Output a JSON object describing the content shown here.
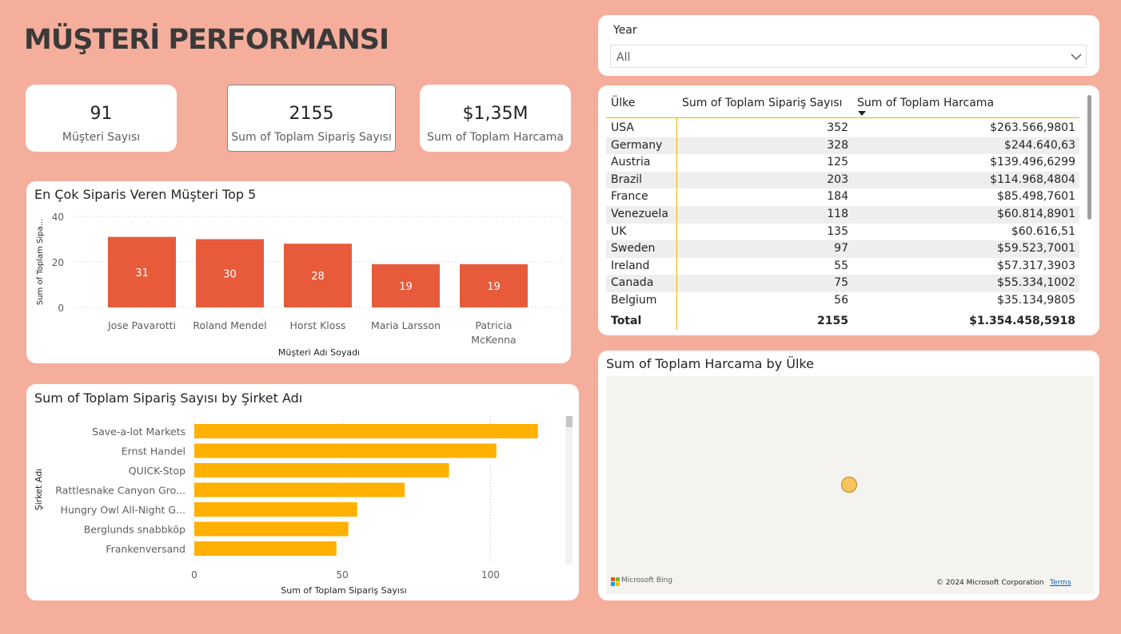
{
  "page": {
    "title": "MÜŞTERİ PERFORMANSI"
  },
  "kpis": [
    {
      "value": "91",
      "label": "Müşteri Sayısı"
    },
    {
      "value": "2155",
      "label": "Sum of Toplam Sipariş Sayısı"
    },
    {
      "value": "$1,35M",
      "label": "Sum of Toplam Harcama"
    }
  ],
  "slicer": {
    "label": "Year",
    "selected": "All"
  },
  "table": {
    "headers": [
      "Ülke",
      "Sum of Toplam Sipariş Sayısı",
      "Sum of Toplam Harcama"
    ],
    "rows": [
      [
        "USA",
        "352",
        "$263.566,9801"
      ],
      [
        "Germany",
        "328",
        "$244.640,63"
      ],
      [
        "Austria",
        "125",
        "$139.496,6299"
      ],
      [
        "Brazil",
        "203",
        "$114.968,4804"
      ],
      [
        "France",
        "184",
        "$85.498,7601"
      ],
      [
        "Venezuela",
        "118",
        "$60.814,8901"
      ],
      [
        "UK",
        "135",
        "$60.616,51"
      ],
      [
        "Sweden",
        "97",
        "$59.523,7001"
      ],
      [
        "Ireland",
        "55",
        "$57.317,3903"
      ],
      [
        "Canada",
        "75",
        "$55.334,1002"
      ],
      [
        "Belgium",
        "56",
        "$35.134,9805"
      ]
    ],
    "total": [
      "Total",
      "2155",
      "$1.354.458,5918"
    ]
  },
  "map": {
    "title": "Sum of Toplam Harcama by Ülke",
    "bing_label": "Microsoft Bing",
    "copyright": "© 2024 Microsoft Corporation",
    "terms": "Terms"
  },
  "colors": {
    "background": "#f5ad9c",
    "bar_orange": "#e85b3a",
    "bar_yellow": "#ffb000",
    "map_bubble": "#f8c45c"
  },
  "chart_data": [
    {
      "type": "bar",
      "title": "En Çok Siparis Veren Müşteri Top 5",
      "xlabel": "Müşteri Adı Soyadı",
      "ylabel": "Sum of Toplam Sipa...",
      "categories": [
        "Jose Pavarotti",
        "Roland Mendel",
        "Horst Kloss",
        "Maria Larsson",
        "Patricia McKenna"
      ],
      "values": [
        31,
        30,
        28,
        19,
        19
      ],
      "yticks": [
        "0",
        "20",
        "40"
      ],
      "ylim": [
        0,
        40
      ],
      "grid": true
    },
    {
      "type": "bar",
      "orientation": "horizontal",
      "title": "Sum of Toplam Sipariş Sayısı by Şirket Adı",
      "xlabel": "Sum of Toplam Sipariş Sayısı",
      "ylabel": "Şirket Adı",
      "categories": [
        "Save-a-lot Markets",
        "Ernst Handel",
        "QUICK-Stop",
        "Rattlesnake Canyon Gro...",
        "Hungry Owl All-Night G...",
        "Berglunds snabbköp",
        "Frankenversand"
      ],
      "values": [
        116,
        102,
        86,
        71,
        55,
        52,
        48
      ],
      "xticks": [
        "0",
        "50",
        "100"
      ],
      "xlim": [
        0,
        125
      ],
      "grid": true
    }
  ]
}
